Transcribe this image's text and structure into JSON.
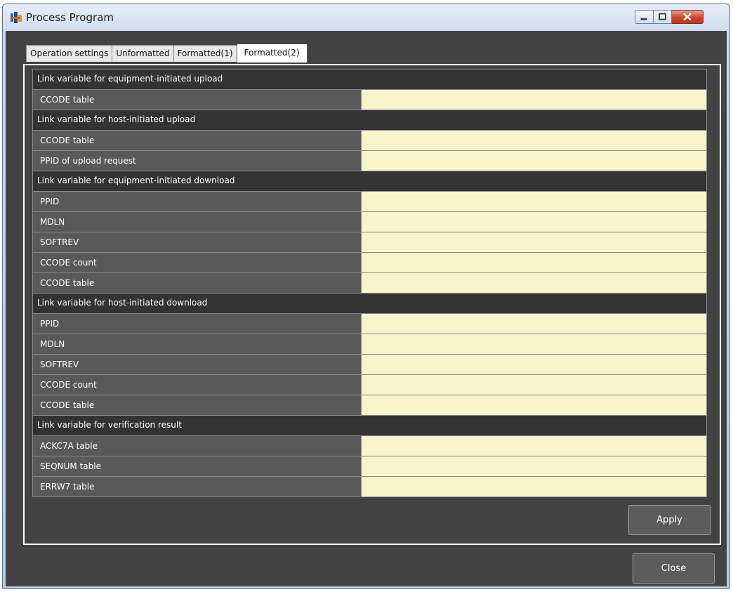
{
  "window": {
    "title": "Process Program",
    "icon": "process-program-app-icon"
  },
  "tabs": [
    "Operation settings",
    "Unformatted",
    "Formatted(1)",
    "Formatted(2)"
  ],
  "active_tab": "Formatted(2)",
  "sections": [
    {
      "title": "Link variable for equipment-initiated upload",
      "rows": [
        {
          "label": "CCODE table",
          "value": ""
        }
      ]
    },
    {
      "title": "Link variable for host-initiated upload",
      "rows": [
        {
          "label": "CCODE table",
          "value": ""
        },
        {
          "label": "PPID of upload request",
          "value": ""
        }
      ]
    },
    {
      "title": "Link variable for equipment-initiated download",
      "rows": [
        {
          "label": "PPID",
          "value": ""
        },
        {
          "label": "MDLN",
          "value": ""
        },
        {
          "label": "SOFTREV",
          "value": ""
        },
        {
          "label": "CCODE count",
          "value": ""
        },
        {
          "label": "CCODE table",
          "value": ""
        }
      ]
    },
    {
      "title": "Link variable for host-initiated download",
      "rows": [
        {
          "label": "PPID",
          "value": ""
        },
        {
          "label": "MDLN",
          "value": ""
        },
        {
          "label": "SOFTREV",
          "value": ""
        },
        {
          "label": "CCODE count",
          "value": ""
        },
        {
          "label": "CCODE table",
          "value": ""
        }
      ]
    },
    {
      "title": "Link variable for verification result",
      "rows": [
        {
          "label": "ACKC7A table",
          "value": ""
        },
        {
          "label": "SEQNUM table",
          "value": ""
        },
        {
          "label": "ERRW7 table",
          "value": ""
        }
      ]
    }
  ],
  "buttons": {
    "apply": "Apply",
    "close": "Close"
  },
  "colors": {
    "panel": "#434343",
    "section_header": "#333333",
    "label_cell": "#595959",
    "value_cell": "#f8f4cb",
    "close_button": "#c9462c"
  }
}
